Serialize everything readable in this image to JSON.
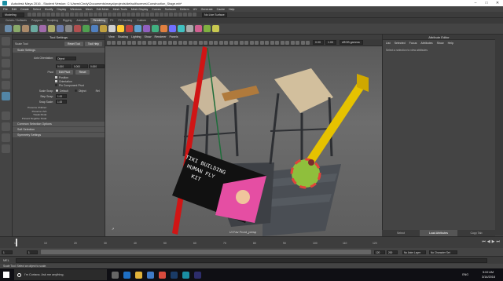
{
  "window": {
    "title": "Autodesk Maya 2016 - Student Version: C:\\Users\\Cindy\\Documents\\maya\\projects\\default\\scenes\\Construction_Stage.mb*",
    "min": "–",
    "max": "□",
    "close": "✕"
  },
  "menubar": [
    "File",
    "Edit",
    "Create",
    "Select",
    "Modify",
    "Display",
    "Windows",
    "Mesh",
    "Edit Mesh",
    "Mesh Tools",
    "Mesh Display",
    "Curves",
    "Surfaces",
    "Deform",
    "UV",
    "Generate",
    "Cache",
    "Help"
  ],
  "statusline": {
    "mode": "Modeling",
    "symmetry": "No Live Surface"
  },
  "shelf_tabs": [
    "Curves / Surfaces",
    "Polygons",
    "Sculpting",
    "Rigging",
    "Animation",
    "Rendering",
    "FX",
    "FX Caching",
    "Custom",
    "XGen"
  ],
  "shelf_active": "Rendering",
  "left_panel": {
    "header": "Tool Settings",
    "tool_name": "Scale Tool",
    "reset_tool": "Reset Tool",
    "tool_help": "Tool Help",
    "section_scale": "Scale Settings",
    "axis_orientation_label": "Axis Orientation:",
    "axis_orientation_value": "Object",
    "pivot_values": [
      "0.000",
      "0.000",
      "0.000"
    ],
    "pivot_label": "Pivot",
    "edit_pivot": "Edit Pivot",
    "reset": "Reset",
    "checks": [
      "Position",
      "Orientation",
      "Pin Component Pivot"
    ],
    "scale_snap_label": "Scale Snap:",
    "radio_default": "Default",
    "radio_object": "Object",
    "radio_rel": "Rel",
    "step_label": "Step Snap:",
    "step_value": "1.00",
    "snap_label": "Snap Scale:",
    "snap_value": "1.00",
    "extra": [
      "Preserve Children:",
      "Preserve UVs:",
      "Tweak Mode:",
      "Prevent Negative Scale:"
    ],
    "sections": [
      "Common Selection Options",
      "Soft Selection",
      "Symmetry Settings"
    ]
  },
  "viewport": {
    "menu": [
      "View",
      "Shading",
      "Lighting",
      "Show",
      "Renderer",
      "Panels"
    ],
    "res_gate": "0.00",
    "scale": "1.00",
    "color_space": "sRGB gamma",
    "camera_label": "UI Fav Front_persp"
  },
  "right_panel": {
    "header": "Attribute Editor",
    "tabs": [
      "List",
      "Selected",
      "Focus",
      "Attributes",
      "Show",
      "Help"
    ],
    "hint": "Select a selection to view attributes",
    "bottom_tabs": [
      "Select",
      "Load Attributes",
      "Copy Tab"
    ],
    "bottom_active": "Load Attributes"
  },
  "sign": {
    "line1": "TIKI BUILDING",
    "line2": "HUMAN FLY",
    "line3": "KIT"
  },
  "time": {
    "start": "1",
    "end": "120",
    "current": "1",
    "range_start": "1",
    "range_end": "200",
    "anim_layer": "No Anim Layer",
    "char_set": "No Character Set",
    "ticks": [
      "1",
      "10",
      "20",
      "30",
      "40",
      "50",
      "60",
      "70",
      "80",
      "90",
      "100",
      "110",
      "120"
    ]
  },
  "mel": {
    "label": "MEL",
    "help": "Scale Tool: Select an object to scale."
  },
  "taskbar": {
    "search_placeholder": "I'm Cortana. Ask me anything.",
    "time": "5:02 AM",
    "date": "3/14/2016",
    "lang": "ENG"
  },
  "colors": {
    "maya_bg": "#444444",
    "accent_blue": "#5285a6",
    "active_yellow": "#e6c200"
  }
}
